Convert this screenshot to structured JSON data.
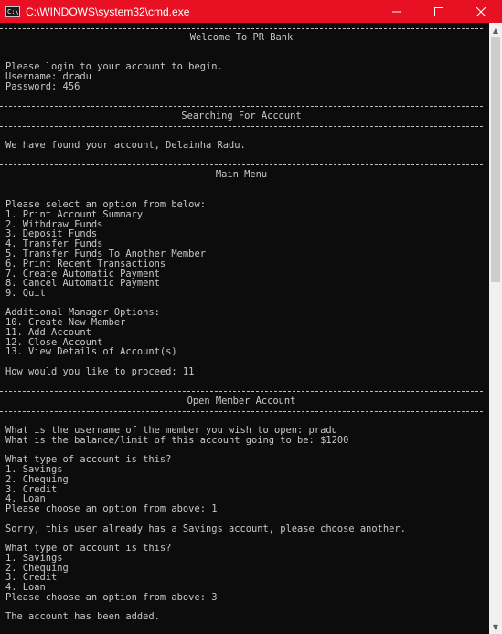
{
  "window": {
    "title": "C:\\WINDOWS\\system32\\cmd.exe",
    "icon_label": "C:\\",
    "minimize_icon": "minimize-icon",
    "maximize_icon": "maximize-icon",
    "close_icon": "close-icon",
    "accent": "#e81123"
  },
  "console": {
    "background": "#0c0c0c",
    "text_color": "#c8c8c8",
    "sections": {
      "welcome": "Welcome To PR Bank",
      "searching": "Searching For Account",
      "main_menu": "Main Menu",
      "open_member": "Open Member Account"
    },
    "login": {
      "prompt": "Please login to your account to begin.",
      "username": "Username: dradu",
      "password": "Password: 456"
    },
    "found": "We have found your account, Delainha Radu.",
    "menu": {
      "prompt": "Please select an option from below:",
      "options": [
        "1. Print Account Summary",
        "2. Withdraw Funds",
        "3. Deposit Funds",
        "4. Transfer Funds",
        "5. Transfer Funds To Another Member",
        "6. Print Recent Transactions",
        "7. Create Automatic Payment",
        "8. Cancel Automatic Payment",
        "9. Quit"
      ],
      "manager_title": "Additional Manager Options:",
      "manager_options": [
        "10. Create New Member",
        "11. Add Account",
        "12. Close Account",
        "13. View Details of Account(s)"
      ],
      "proceed": "How would you like to proceed: 11"
    },
    "open": {
      "username_q": "What is the username of the member you wish to open: pradu",
      "balance_q": "What is the balance/limit of this account going to be: $1200",
      "type_q": "What type of account is this?",
      "types": [
        "1. Savings",
        "2. Chequing",
        "3. Credit",
        "4. Loan"
      ],
      "choose_1": "Please choose an option from above: 1",
      "error": "Sorry, this user already has a Savings account, please choose another.",
      "type_q2": "What type of account is this?",
      "types2": [
        "1. Savings",
        "2. Chequing",
        "3. Credit",
        "4. Loan"
      ],
      "choose_2": "Please choose an option from above: 3",
      "added": "The account has been added."
    }
  }
}
